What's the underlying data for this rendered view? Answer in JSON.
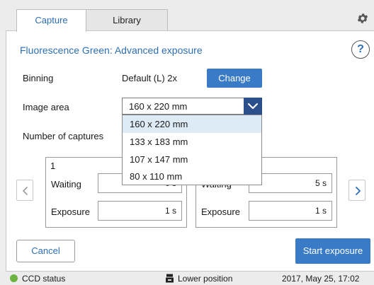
{
  "tabs": [
    {
      "label": "Capture",
      "active": true
    },
    {
      "label": "Library",
      "active": false
    }
  ],
  "icons": {
    "settings": "gear-icon",
    "help": "help-icon",
    "dropdown": "chevron-down-icon",
    "prev": "chevron-left-icon",
    "next": "chevron-right-icon",
    "status": "status-dot",
    "position": "tray-icon"
  },
  "header": {
    "title": "Fluorescence Green: Advanced exposure",
    "help_label": "?"
  },
  "binning": {
    "label": "Binning",
    "value": "Default (L) 2x",
    "button": "Change"
  },
  "image_area": {
    "label": "Image area",
    "selected": "160 x 220 mm",
    "options": [
      "160 x 220 mm",
      "133 x 183 mm",
      "107 x 147 mm",
      "80 x 110 mm"
    ]
  },
  "captures": {
    "label": "Number of captures",
    "groups": [
      {
        "number": "1",
        "waiting_label": "Waiting",
        "waiting_value": "0 s",
        "exposure_label": "Exposure",
        "exposure_value": "1 s"
      },
      {
        "number": "",
        "waiting_label": "Waiting",
        "waiting_value": "5 s",
        "exposure_label": "Exposure",
        "exposure_value": "1 s"
      }
    ]
  },
  "actions": {
    "cancel": "Cancel",
    "start": "Start exposure"
  },
  "status": {
    "ccd": "CCD status",
    "position": "Lower position",
    "datetime": "2017, May 25, 17:02"
  },
  "colors": {
    "accent": "#2d6fb5",
    "primary_button": "#3a7bc8",
    "status_ok": "#6db33f",
    "selected_option": "#dcebf5"
  }
}
